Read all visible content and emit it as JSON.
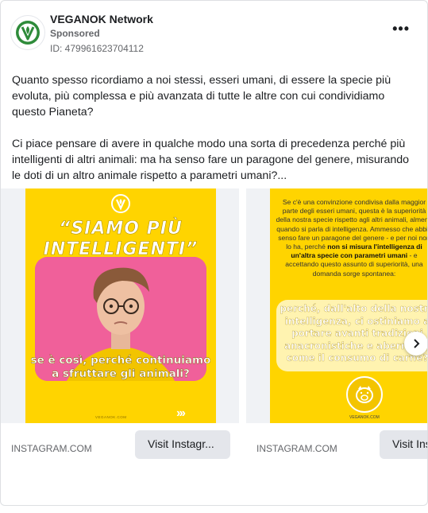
{
  "post": {
    "page_name": "VEGANOK Network",
    "sponsored": "Sponsored",
    "ad_id": "ID: 479961623704112",
    "more_label": "•••",
    "paragraphs": [
      "Quanto spesso ricordiamo a noi stessi, esseri umani, di essere la specie più evoluta, più complessa e più avanzata di tutte le altre con cui condividiamo questo Pianeta?",
      "Ci piace pensare di avere in qualche modo una sorta di precedenza perché più intelligenti di altri animali: ma ha senso fare un paragone del genere, misurando le doti di un altro animale rispetto a parametri umani?..."
    ]
  },
  "carousel": {
    "cards": [
      {
        "headline": "“SIAMO PIÙ INTELLIGENTI”",
        "overlay": "se è così, perché continuiamo a sfruttare gli animali?",
        "brand": "VEGANOK.COM",
        "chevrons": "›››",
        "source": "INSTAGRAM.COM",
        "cta": "Visit Instagr..."
      },
      {
        "small_text_1": "Se c'è una convinzione condivisa dalla maggior parte degli esseri umani, questa è la superiorità della nostra specie rispetto agli altri animali, almeno quando si parla di intelligenza. Ammesso che abbia senso fare un paragone del genere - e per noi non lo ha, perché ",
        "small_text_bold": "non si misura l'intelligenza di un'altra specie con parametri umani",
        "small_text_2": " - e accettando questo assunto di superiorità, una domanda sorge spontanea:",
        "box_text": "perché, dall'alto della nostra intelligenza, ci ostiniamo a portare avanti tradizioni anacronistiche e aberranti, come il consumo di carne?",
        "brand": "VEGANOK.COM",
        "source": "INSTAGRAM.COM",
        "cta": "Visit Instagram"
      }
    ],
    "next_icon": "chevron-right"
  },
  "colors": {
    "brand_yellow": "#ffd400",
    "photo_pink": "#f0609a",
    "logo_green": "#2e8b3a"
  }
}
